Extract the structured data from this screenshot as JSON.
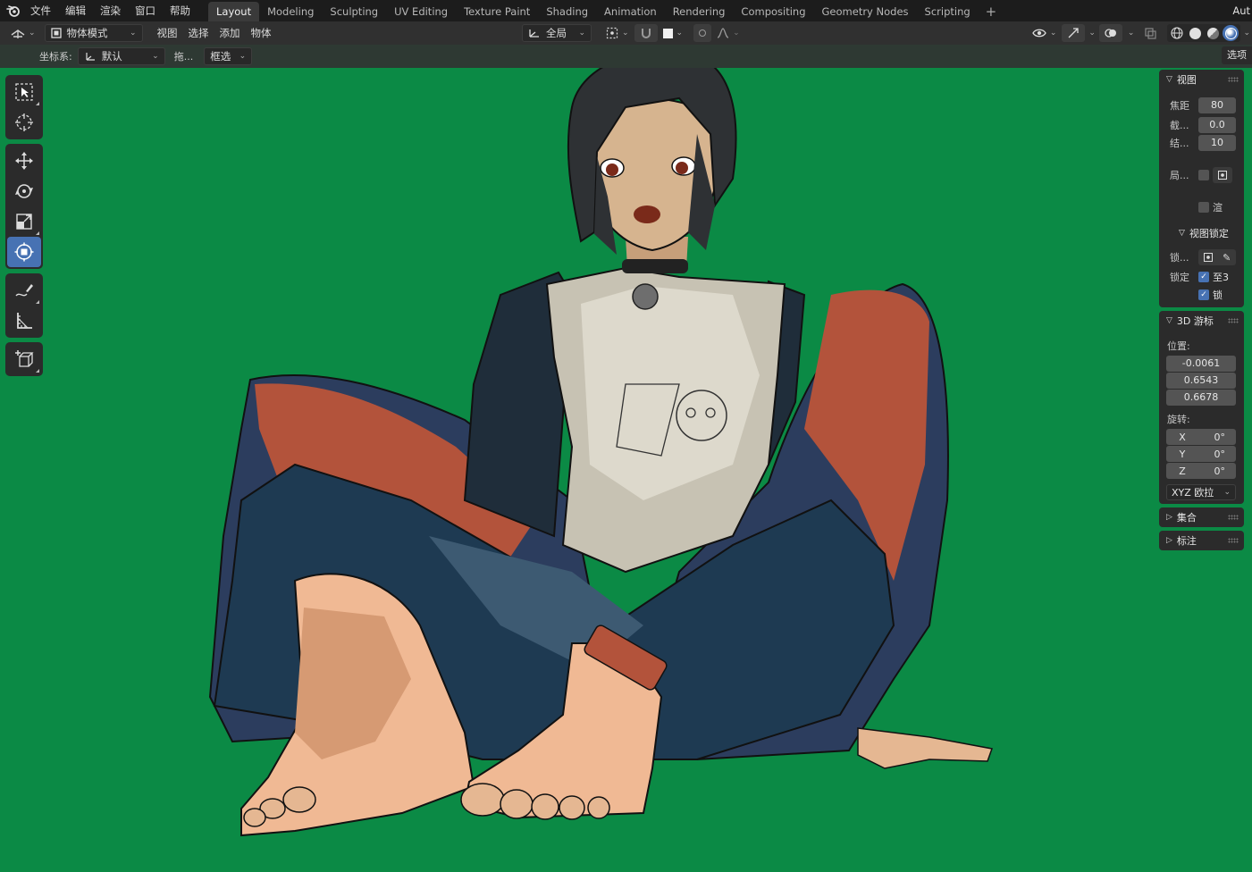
{
  "menu": {
    "items": [
      "文件",
      "编辑",
      "渲染",
      "窗口",
      "帮助"
    ]
  },
  "workspaces": {
    "tabs": [
      "Layout",
      "Modeling",
      "Sculpting",
      "UV Editing",
      "Texture Paint",
      "Shading",
      "Animation",
      "Rendering",
      "Compositing",
      "Geometry Nodes",
      "Scripting"
    ],
    "active": "Layout",
    "add": "+",
    "right_text": "Aut"
  },
  "header": {
    "mode": "物体模式",
    "menus": [
      "视图",
      "选择",
      "添加",
      "物体"
    ],
    "transform_orientation": "全局"
  },
  "toolheader": {
    "coord_label": "坐标系:",
    "coord_value": "默认",
    "drag_label": "拖...",
    "drag_value": "框选",
    "options_tab": "选项"
  },
  "sidebar": {
    "view_panel": {
      "title": "视图",
      "focal_label": "焦距",
      "focal_value": "80",
      "clip_start_label": "截...",
      "clip_start_value": "0.0",
      "clip_end_label": "结...",
      "clip_end_value": "10",
      "local_label": "局...",
      "render_label": "渲",
      "lock_title": "视图锁定",
      "lock_obj_label": "锁...",
      "lock_label": "锁定",
      "lock_to_3d": "至3",
      "lock_cam": "锁"
    },
    "cursor_panel": {
      "title": "3D 游标",
      "location_label": "位置:",
      "loc": [
        "-0.0061",
        "0.6543",
        "0.6678"
      ],
      "rotation_label": "旋转:",
      "rot_axes": [
        "X",
        "Y",
        "Z"
      ],
      "rot_values": [
        "0°",
        "0°",
        "0°"
      ],
      "rot_mode": "XYZ 欧拉"
    },
    "collection_panel": {
      "title": "集合"
    },
    "annotation_panel": {
      "title": "标注"
    }
  },
  "colors": {
    "viewport_bg": "#0b8a45",
    "accent": "#4772b3"
  }
}
